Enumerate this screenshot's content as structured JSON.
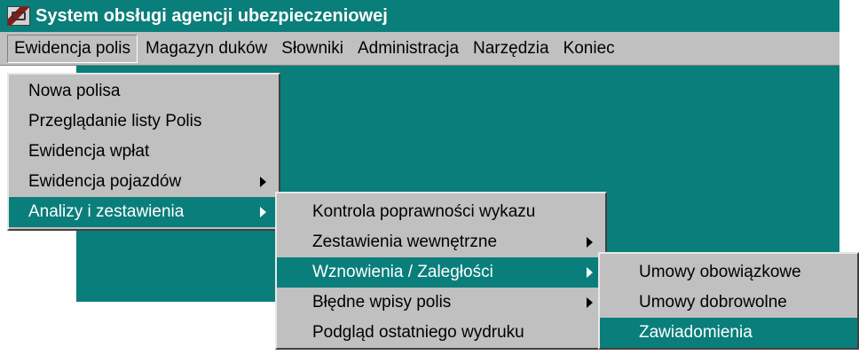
{
  "window": {
    "title": "System obsługi agencji ubezpieczeniowej",
    "accent_color": "#0a7e7a",
    "app_icon": "app-icon"
  },
  "menubar": {
    "items": [
      {
        "label": "Ewidencja polis"
      },
      {
        "label": "Magazyn duków"
      },
      {
        "label": "Słowniki"
      },
      {
        "label": "Administracja"
      },
      {
        "label": "Narzędzia"
      },
      {
        "label": "Koniec"
      }
    ]
  },
  "menu_ewidencja": {
    "items": [
      {
        "label": "Nowa polisa"
      },
      {
        "label": "Przeglądanie listy Polis"
      },
      {
        "label": "Ewidencja wpłat"
      },
      {
        "label": "Ewidencja pojazdów"
      },
      {
        "label": "Analizy i zestawienia"
      }
    ]
  },
  "menu_analizy": {
    "items": [
      {
        "label": "Kontrola poprawności wykazu"
      },
      {
        "label": "Zestawienia wewnętrzne"
      },
      {
        "label": "Wznowienia / Zaległości"
      },
      {
        "label": "Błędne wpisy polis"
      },
      {
        "label": "Podgląd ostatniego wydruku"
      }
    ]
  },
  "menu_wznowienia": {
    "items": [
      {
        "label": "Umowy obowiązkowe"
      },
      {
        "label": "Umowy dobrowolne"
      },
      {
        "label": "Zawiadomienia"
      }
    ]
  }
}
